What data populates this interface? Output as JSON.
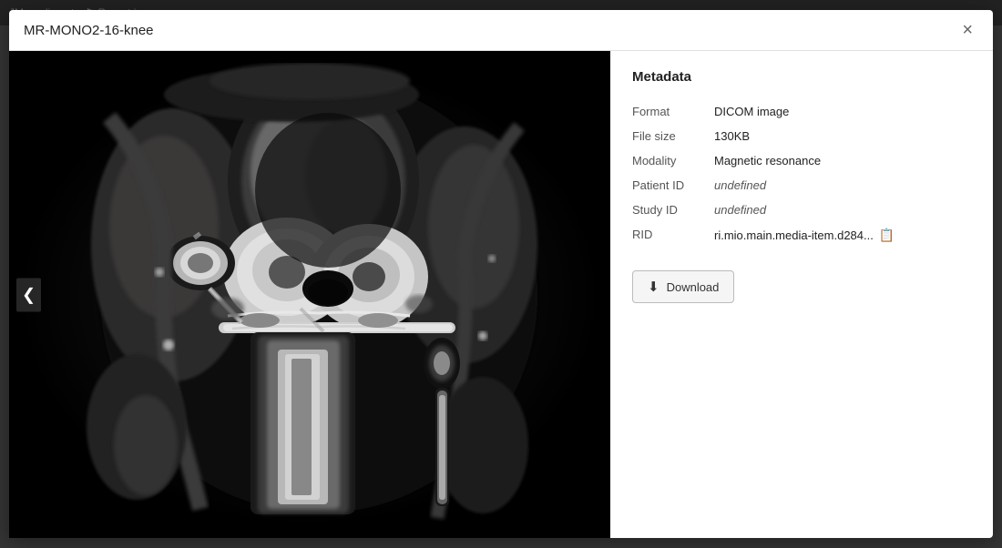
{
  "modal": {
    "title": "MR-MONO2-16-knee",
    "close_label": "×"
  },
  "metadata": {
    "heading": "Metadata",
    "fields": [
      {
        "key": "Format",
        "value": "DICOM image",
        "italic": false
      },
      {
        "key": "File size",
        "value": "130KB",
        "italic": false
      },
      {
        "key": "Modality",
        "value": "Magnetic resonance",
        "italic": false
      },
      {
        "key": "Patient ID",
        "value": "undefined",
        "italic": true
      },
      {
        "key": "Study ID",
        "value": "undefined",
        "italic": true
      },
      {
        "key": "RID",
        "value": "ri.mio.main.media-item.d284...",
        "italic": false
      }
    ]
  },
  "download": {
    "label": "Download",
    "icon": "⬇"
  },
  "nav": {
    "prev_label": "❮"
  },
  "appbar": {
    "items": [
      "JM media set",
      "Report issue"
    ]
  }
}
